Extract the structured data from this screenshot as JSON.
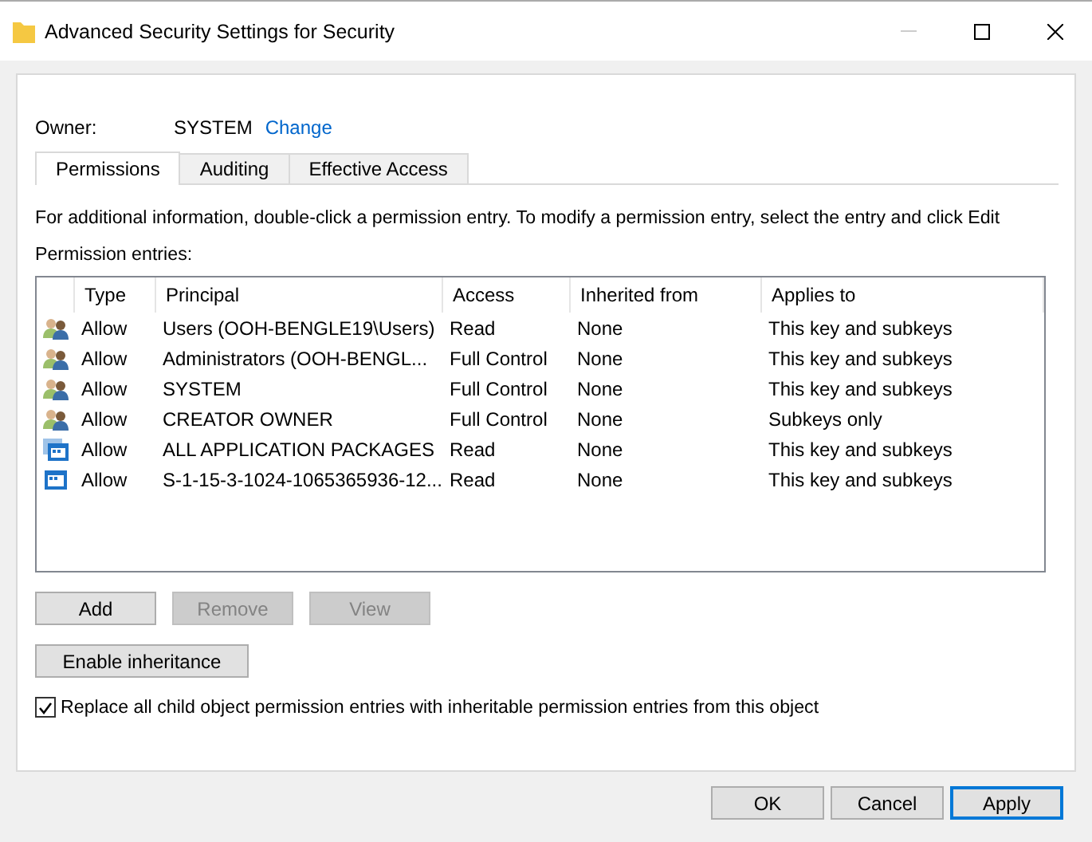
{
  "window": {
    "title": "Advanced Security Settings for Security"
  },
  "owner": {
    "label": "Owner:",
    "value": "SYSTEM",
    "link": "Change"
  },
  "tabs": [
    {
      "label": "Permissions",
      "selected": true
    },
    {
      "label": "Auditing",
      "selected": false
    },
    {
      "label": "Effective Access",
      "selected": false
    }
  ],
  "info": "For additional information, double-click a permission entry. To modify a permission entry, select the entry and click Edit",
  "entries_label": "Permission entries:",
  "table": {
    "columns": [
      "Type",
      "Principal",
      "Access",
      "Inherited from",
      "Applies to"
    ],
    "rows": [
      {
        "kind": "group",
        "cells": [
          "Allow",
          "Users (OOH-BENGLE19\\Users)",
          "Read",
          "None",
          "This key and subkeys"
        ]
      },
      {
        "kind": "group",
        "cells": [
          "Allow",
          "Administrators (OOH-BENGL...",
          "Full Control",
          "None",
          "This key and subkeys"
        ]
      },
      {
        "kind": "group",
        "cells": [
          "Allow",
          "SYSTEM",
          "Full Control",
          "None",
          "This key and subkeys"
        ]
      },
      {
        "kind": "group",
        "cells": [
          "Allow",
          "CREATOR OWNER",
          "Full Control",
          "None",
          "Subkeys only"
        ]
      },
      {
        "kind": "package",
        "cells": [
          "Allow",
          "ALL APPLICATION PACKAGES",
          "Read",
          "None",
          "This key and subkeys"
        ]
      },
      {
        "kind": "app",
        "cells": [
          "Allow",
          "S-1-15-3-1024-1065365936-12...",
          "Read",
          "None",
          "This key and subkeys"
        ]
      }
    ]
  },
  "entry_buttons": [
    {
      "label": "Add",
      "disabled": false
    },
    {
      "label": "Remove",
      "disabled": true
    },
    {
      "label": "View",
      "disabled": true
    }
  ],
  "inheritance_button": "Enable inheritance",
  "replace_checkbox": {
    "label": "Replace all child object permission entries with inheritable permission entries from this object",
    "checked": true
  },
  "footer_buttons": [
    {
      "label": "OK",
      "focused": false
    },
    {
      "label": "Cancel",
      "focused": false
    },
    {
      "label": "Apply",
      "focused": true
    }
  ]
}
